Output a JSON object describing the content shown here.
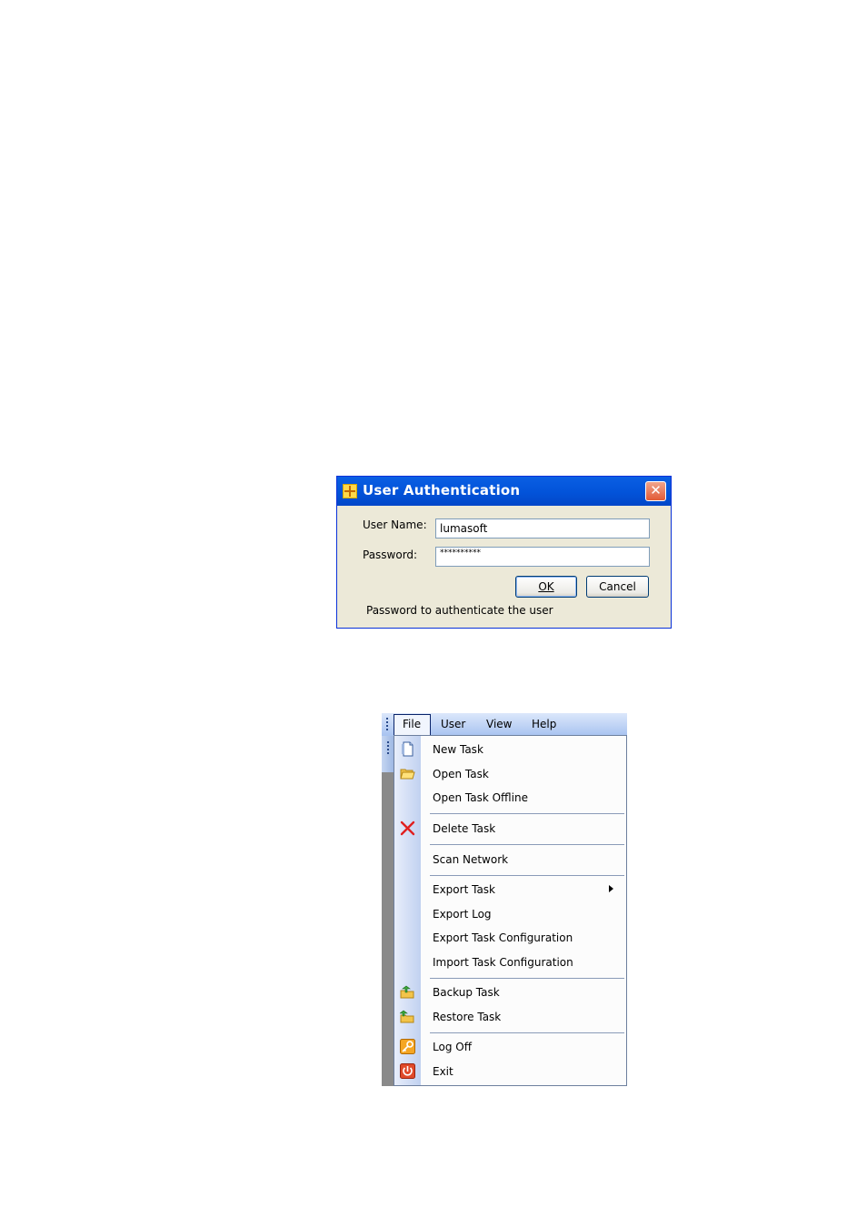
{
  "dialog": {
    "title": "User Authentication",
    "close_symbol": "✕",
    "user_name_label": "User Name:",
    "user_name_value": "lumasoft",
    "password_label": "Password:",
    "password_value": "**********",
    "ok_label": "OK",
    "cancel_label": "Cancel",
    "status_text": "Password to authenticate the user",
    "icons": {
      "app": "app-icon",
      "close": "close-icon"
    }
  },
  "menubar": {
    "items": [
      {
        "label": "File"
      },
      {
        "label": "User"
      },
      {
        "label": "View"
      },
      {
        "label": "Help"
      }
    ]
  },
  "file_menu": {
    "items": [
      {
        "label": "New Task",
        "icon": "new-document-icon"
      },
      {
        "label": "Open Task",
        "icon": "open-folder-icon"
      },
      {
        "label": "Open Task Offline",
        "icon": ""
      },
      {
        "label": "Delete Task",
        "icon": "delete-x-icon"
      },
      {
        "label": "Scan Network",
        "icon": ""
      },
      {
        "label": "Export Task",
        "icon": "",
        "submenu": true
      },
      {
        "label": "Export Log",
        "icon": ""
      },
      {
        "label": "Export Task Configuration",
        "icon": ""
      },
      {
        "label": "Import Task Configuration",
        "icon": ""
      },
      {
        "label": "Backup Task",
        "icon": "backup-folder-icon"
      },
      {
        "label": "Restore Task",
        "icon": "restore-folder-icon"
      },
      {
        "label": "Log Off",
        "icon": "key-icon"
      },
      {
        "label": "Exit",
        "icon": "power-icon"
      }
    ]
  },
  "colors": {
    "titlebar": "#0253d9",
    "dialog_bg": "#ece9d8",
    "close_button": "#e25a36",
    "menubar": "#a8c3f0"
  }
}
